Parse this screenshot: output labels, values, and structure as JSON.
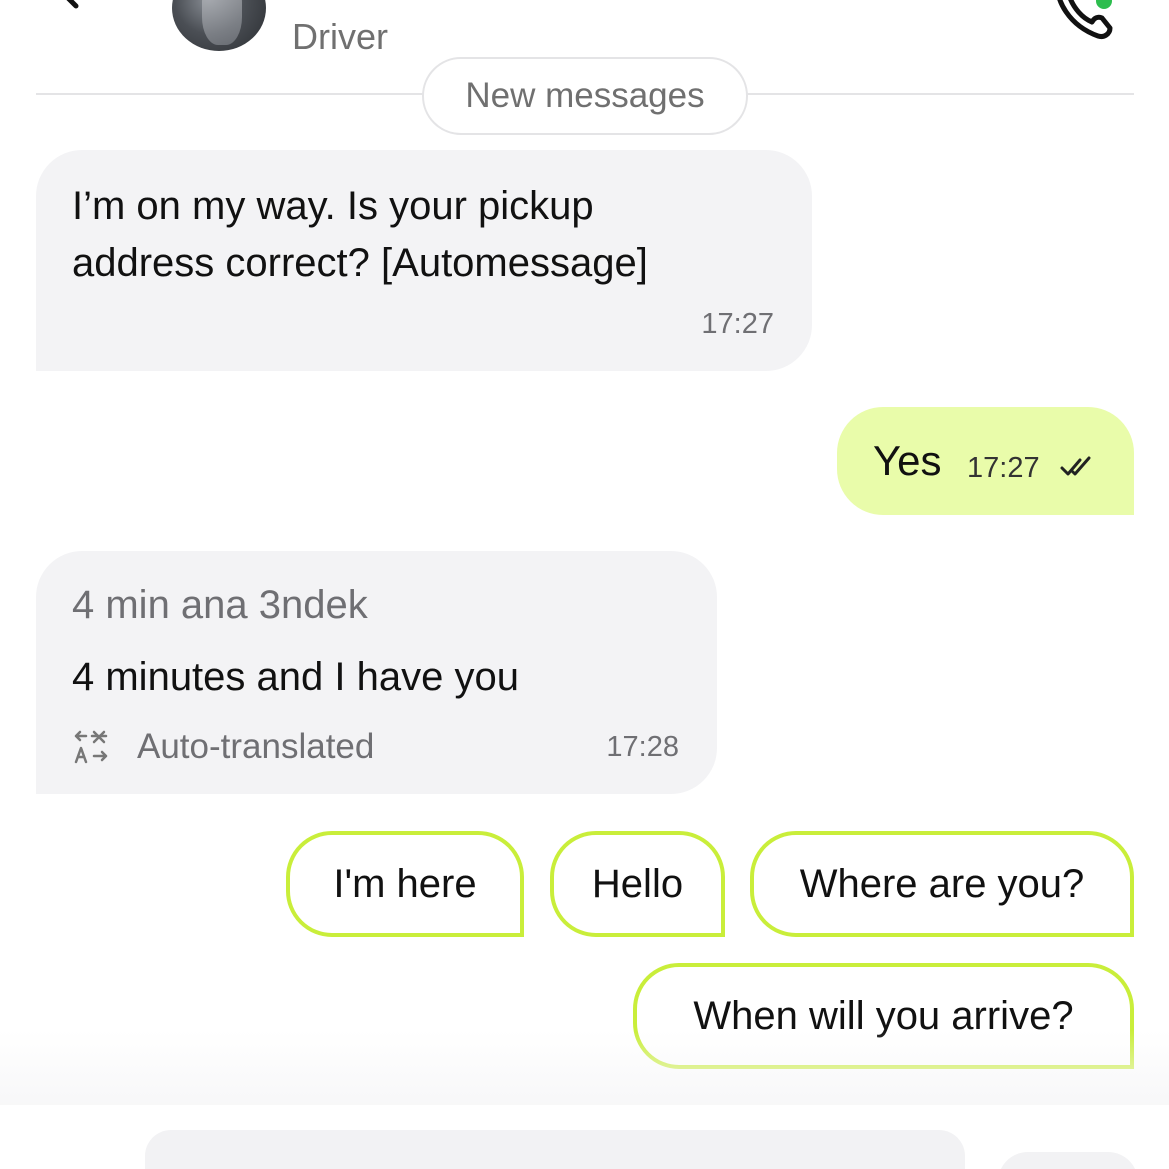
{
  "header": {
    "role": "Driver",
    "back_icon": "arrow-left-icon",
    "call_icon": "phone-icon",
    "online_color": "#2dbd4e"
  },
  "divider": {
    "label": "New messages"
  },
  "messages": [
    {
      "direction": "incoming",
      "text": "I’m on my way. Is your pickup address correct? [Automessage]",
      "time": "17:27"
    },
    {
      "direction": "outgoing",
      "text": "Yes",
      "time": "17:27",
      "status_icon": "double-check-icon"
    },
    {
      "direction": "incoming",
      "original": "4 min ana 3ndek",
      "translation": "4 minutes and I have you",
      "translation_label": "Auto-translated",
      "translation_icon": "translate-icon",
      "time": "17:28"
    }
  ],
  "quick_replies": [
    "I'm here",
    "Hello",
    "Where are you?",
    "When will you arrive?"
  ],
  "colors": {
    "accent": "#c9ee3a",
    "outgoing_bubble": "#e9fcaa",
    "incoming_bubble": "#f3f3f5"
  }
}
